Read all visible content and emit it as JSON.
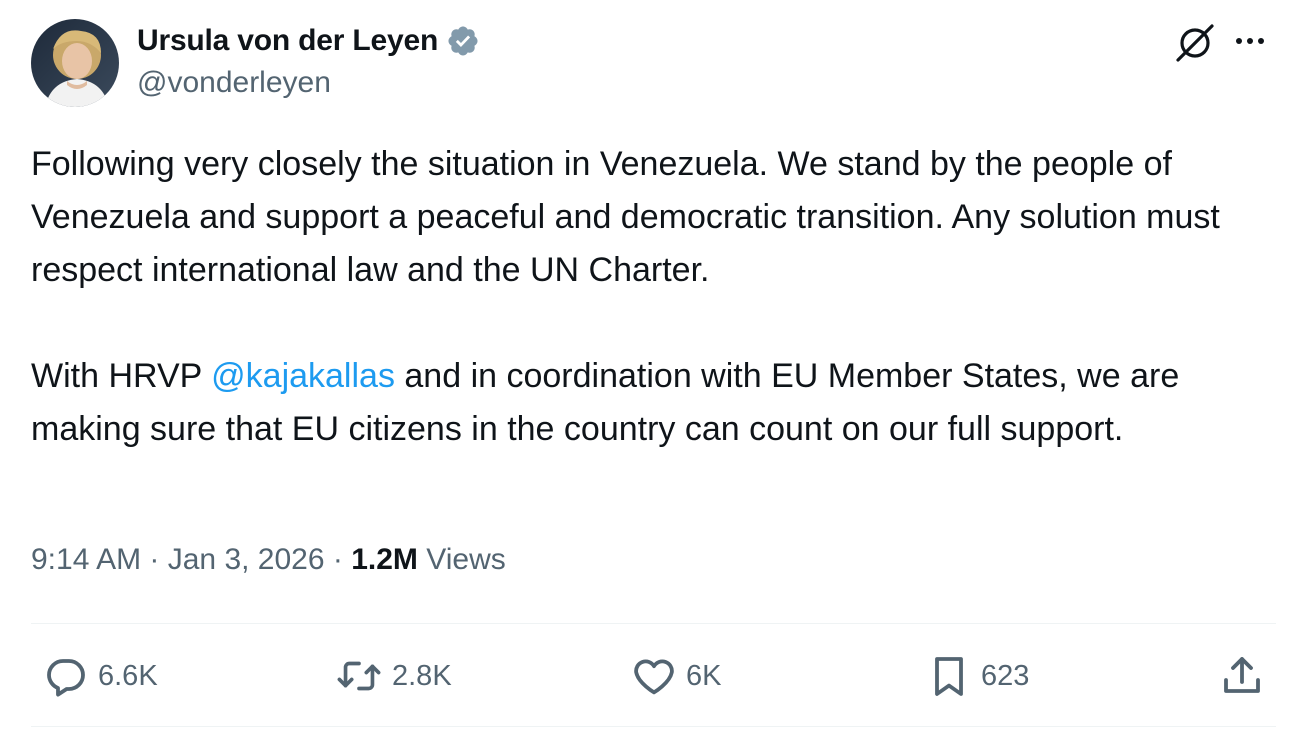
{
  "author": {
    "display_name": "Ursula von der Leyen",
    "handle": "@vonderleyen",
    "verified": true
  },
  "header_actions": {
    "grok_icon": "grok-icon",
    "more_icon": "more-icon"
  },
  "tweet": {
    "para1": "Following very closely the situation in Venezuela. We stand by the people of Venezuela and support a peaceful and democratic transition. Any solution must respect international law and the UN Charter.",
    "para2_before": "With HRVP ",
    "mention": "@kajakallas",
    "para2_after": " and in coordination with EU Member States, we are making sure that EU citizens in the country can count on our full support."
  },
  "meta": {
    "time": "9:14 AM",
    "sep1": " · ",
    "date": "Jan 3, 2026",
    "sep2": " · ",
    "views_count": "1.2M",
    "views_label": " Views"
  },
  "actions": {
    "replies": "6.6K",
    "reposts": "2.8K",
    "likes": "6K",
    "bookmarks": "623"
  },
  "colors": {
    "text": "#0f1419",
    "secondary": "#536471",
    "link": "#1d9bf0",
    "verified": "#829aab",
    "divider": "#eff3f4"
  }
}
